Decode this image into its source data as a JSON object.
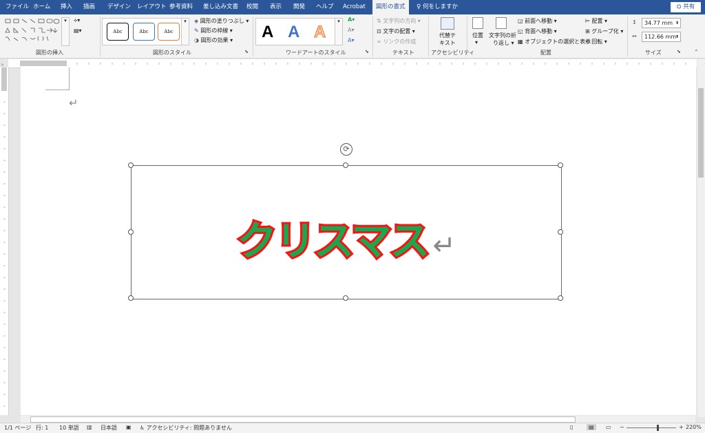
{
  "tabs": [
    "ファイル",
    "ホーム",
    "挿入",
    "描画",
    "デザイン",
    "レイアウト",
    "参考資料",
    "差し込み文書",
    "校閲",
    "表示",
    "開発",
    "ヘルプ",
    "Acrobat",
    "図形の書式"
  ],
  "tell_me": "何をしますか",
  "share": "共有",
  "ribbon": {
    "insert_shapes_label": "図形の挿入",
    "shape_styles_label": "図形のスタイル",
    "shape_style_sample": "Abc",
    "shape_fill": "図形の塗りつぶし",
    "shape_outline": "図形の枠線",
    "shape_effects": "図形の効果",
    "wordart_label": "ワードアートのスタイル",
    "wordart_sample": "A",
    "text_direction": "文字列の方向",
    "text_align": "文字の配置",
    "create_link": "リンクの作成",
    "text_label": "テキスト",
    "alt_text_l1": "代替テ",
    "alt_text_l2": "キスト",
    "accessibility_label": "アクセシビリティ",
    "position": "位置",
    "wrap_text_l1": "文字列の折",
    "wrap_text_l2": "り返し",
    "bring_forward": "前面へ移動",
    "send_backward": "背面へ移動",
    "selection_pane": "オブジェクトの選択と表示",
    "align": "配置",
    "group": "グループ化",
    "rotate": "回転",
    "arrange_label": "配置",
    "height": "34.77 mm",
    "width": "112.66 mm",
    "size_label": "サイズ"
  },
  "document": {
    "wordart_text": "クリスマス",
    "paragraph_mark": "↵"
  },
  "status": {
    "page": "1/1 ページ",
    "line": "行: 1",
    "words": "10 単語",
    "language": "日本語",
    "accessibility": "アクセシビリティ: 問題ありません",
    "zoom": "220%"
  },
  "colors": {
    "tab_bar": "#2b579a",
    "wordart_fill": "#1aa74f",
    "wordart_outline": "#ff1010"
  }
}
